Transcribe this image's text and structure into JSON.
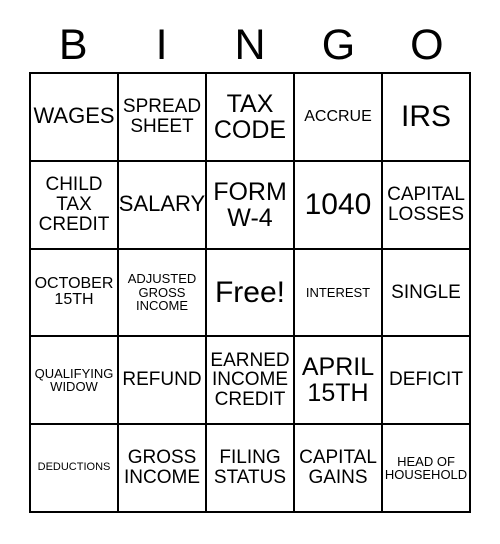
{
  "card": {
    "title_letters": [
      "B",
      "I",
      "N",
      "G",
      "O"
    ],
    "free_space_label": "Free!",
    "rows": [
      [
        {
          "text": "WAGES",
          "size": "lg"
        },
        {
          "text": "SPREAD\nSHEET",
          "size": "md"
        },
        {
          "text": "TAX\nCODE",
          "size": "xl"
        },
        {
          "text": "ACCRUE",
          "size": "sm"
        },
        {
          "text": "IRS",
          "size": "xxl"
        }
      ],
      [
        {
          "text": "CHILD\nTAX\nCREDIT",
          "size": "md"
        },
        {
          "text": "SALARY",
          "size": "lg"
        },
        {
          "text": "FORM\nW-4",
          "size": "xl"
        },
        {
          "text": "1040",
          "size": "xxl"
        },
        {
          "text": "CAPITAL\nLOSSES",
          "size": "md"
        }
      ],
      [
        {
          "text": "OCTOBER\n15TH",
          "size": "sm"
        },
        {
          "text": "ADJUSTED\nGROSS\nINCOME",
          "size": "xs"
        },
        {
          "text": "Free!",
          "size": "xxl"
        },
        {
          "text": "INTEREST",
          "size": "xs"
        },
        {
          "text": "SINGLE",
          "size": "md"
        }
      ],
      [
        {
          "text": "QUALIFYING\nWIDOW",
          "size": "xs"
        },
        {
          "text": "REFUND",
          "size": "md"
        },
        {
          "text": "EARNED\nINCOME\nCREDIT",
          "size": "md"
        },
        {
          "text": "APRIL\n15TH",
          "size": "xl"
        },
        {
          "text": "DEFICIT",
          "size": "md"
        }
      ],
      [
        {
          "text": "DEDUCTIONS",
          "size": "xxs"
        },
        {
          "text": "GROSS\nINCOME",
          "size": "md"
        },
        {
          "text": "FILING\nSTATUS",
          "size": "md"
        },
        {
          "text": "CAPITAL\nGAINS",
          "size": "md"
        },
        {
          "text": "HEAD OF\nHOUSEHOLD",
          "size": "xs"
        }
      ]
    ]
  },
  "colors": {
    "border": "#000000",
    "background": "#ffffff",
    "text": "#000000"
  }
}
